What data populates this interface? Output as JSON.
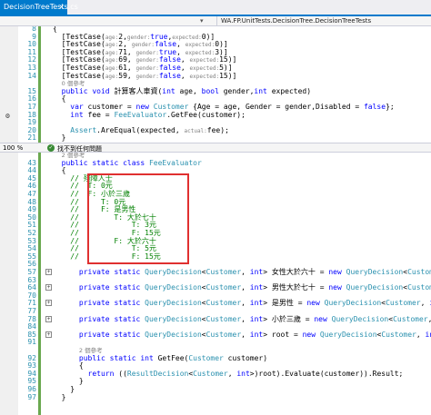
{
  "tabs": {
    "active": "DecisionTreeTests.cs",
    "close_glyph": "×",
    "dropdown_glyph": "▾"
  },
  "navbar": {
    "left_label": "",
    "dropdown_value": "WA.FP.UnitTests.DecisionTree.DecisionTreeTests"
  },
  "top_editor": {
    "lines": [
      {
        "n": "8",
        "html": "{"
      },
      {
        "n": "9",
        "html": "  [TestCase(<span class='pn'>age:</span>2,<span class='pn'>gender:</span><span class='kw'>true</span>,<span class='pn'>expected:</span>0)]"
      },
      {
        "n": "10",
        "html": "  [TestCase(<span class='pn'>age:</span>2, <span class='pn'>gender:</span><span class='kw'>false</span>, <span class='pn'>expected:</span>0)]"
      },
      {
        "n": "11",
        "html": "  [TestCase(<span class='pn'>age:</span>71, <span class='pn'>gender:</span><span class='kw'>true</span>, <span class='pn'>expected:</span>3)]"
      },
      {
        "n": "12",
        "html": "  [TestCase(<span class='pn'>age:</span>69, <span class='pn'>gender:</span><span class='kw'>false</span>, <span class='pn'>expected:</span>15)]"
      },
      {
        "n": "13",
        "html": "  [TestCase(<span class='pn'>age:</span>61, <span class='pn'>gender:</span><span class='kw'>false</span>, <span class='pn'>expected:</span>5)]"
      },
      {
        "n": "14",
        "html": "  [TestCase(<span class='pn'>age:</span>59, <span class='pn'>gender:</span><span class='kw'>false</span>, <span class='pn'>expected:</span>15)]"
      },
      {
        "n": "",
        "html": "  <span class='ref'>0 個參考</span>"
      },
      {
        "n": "15",
        "html": "  <span class='kw'>public void</span> 計算客人車資(<span class='kw'>int</span> age, <span class='kw'>bool</span> gender,<span class='kw'>int</span> expected)"
      },
      {
        "n": "16",
        "html": "  {"
      },
      {
        "n": "17",
        "html": "    <span class='kw'>var</span> customer = <span class='kw'>new</span> <span class='ty'>Customer</span> {Age = age, Gender = gender,Disabled = <span class='kw'>false</span>};"
      },
      {
        "n": "18",
        "html": "    <span class='kw'>int</span> fee = <span class='ty'>FeeEvaluator</span>.GetFee(customer);"
      },
      {
        "n": "19",
        "html": ""
      },
      {
        "n": "20",
        "html": "    <span class='ty'>Assert</span>.AreEqual(expected, <span class='pn'>actual:</span>fee);"
      },
      {
        "n": "21",
        "html": "  }"
      }
    ]
  },
  "status": {
    "zoom": "100 %",
    "issues_text": "找不到任何問題",
    "check_glyph": "✓"
  },
  "bottom_editor": {
    "lines": [
      {
        "n": "",
        "html": "  <span class='ref'>2 個參考</span>"
      },
      {
        "n": "43",
        "html": "  <span class='kw'>public static class</span> <span class='ty'>FeeEvaluator</span>"
      },
      {
        "n": "44",
        "html": "  {"
      },
      {
        "n": "45",
        "html": "    <span class='cm'>// 殘障人士</span>"
      },
      {
        "n": "46",
        "html": "    <span class='cm'>//  T: 0元</span>"
      },
      {
        "n": "47",
        "html": "    <span class='cm'>//  F: 小於三歲</span>"
      },
      {
        "n": "48",
        "html": "    <span class='cm'>//     T: 0元</span>"
      },
      {
        "n": "49",
        "html": "    <span class='cm'>//     F: 是男性</span>"
      },
      {
        "n": "50",
        "html": "    <span class='cm'>//        T: 大於七十</span>"
      },
      {
        "n": "51",
        "html": "    <span class='cm'>//            T: 3元</span>"
      },
      {
        "n": "52",
        "html": "    <span class='cm'>//            F: 15元</span>"
      },
      {
        "n": "53",
        "html": "    <span class='cm'>//        F: 大於六十</span>"
      },
      {
        "n": "54",
        "html": "    <span class='cm'>//            T: 5元</span>"
      },
      {
        "n": "55",
        "html": "    <span class='cm'>//            F: 15元</span>"
      },
      {
        "n": "56",
        "html": ""
      },
      {
        "n": "57",
        "html": "      <span class='kw'>private static</span> <span class='ty'>QueryDecision</span>&lt;<span class='ty'>Customer</span>, <span class='kw'>int</span>&gt; 女性大於六十 = <span class='kw'>new</span> <span class='ty'>QueryDecision</span>&lt;<span class='ty'>Customer</span>, <span class='kw'>int</span>&gt;<span class='coll'>...</span>;"
      },
      {
        "n": "63",
        "html": ""
      },
      {
        "n": "64",
        "html": "      <span class='kw'>private static</span> <span class='ty'>QueryDecision</span>&lt;<span class='ty'>Customer</span>, <span class='kw'>int</span>&gt; 男性大於七十 = <span class='kw'>new</span> <span class='ty'>QueryDecision</span>&lt;<span class='ty'>Customer</span>, <span class='kw'>int</span>&gt;<span class='coll'>...</span>;"
      },
      {
        "n": "70",
        "html": ""
      },
      {
        "n": "71",
        "html": "      <span class='kw'>private static</span> <span class='ty'>QueryDecision</span>&lt;<span class='ty'>Customer</span>, <span class='kw'>int</span>&gt; 是男性 = <span class='kw'>new</span> <span class='ty'>QueryDecision</span>&lt;<span class='ty'>Customer</span>, <span class='kw'>int</span>&gt;<span class='coll'>...</span>;"
      },
      {
        "n": "77",
        "html": ""
      },
      {
        "n": "78",
        "html": "      <span class='kw'>private static</span> <span class='ty'>QueryDecision</span>&lt;<span class='ty'>Customer</span>, <span class='kw'>int</span>&gt; 小於三歲 = <span class='kw'>new</span> <span class='ty'>QueryDecision</span>&lt;<span class='ty'>Customer</span>, <span class='kw'>int</span>&gt;<span class='coll'>...</span>;"
      },
      {
        "n": "84",
        "html": ""
      },
      {
        "n": "85",
        "html": "      <span class='kw'>private static</span> <span class='ty'>QueryDecision</span>&lt;<span class='ty'>Customer</span>, <span class='kw'>int</span>&gt; root = <span class='kw'>new</span> <span class='ty'>QueryDecision</span>&lt;<span class='ty'>Customer</span>, <span class='kw'>int</span>&gt;<span class='coll'>...</span>;"
      },
      {
        "n": "91",
        "html": ""
      },
      {
        "n": "",
        "html": "      <span class='ref'>2 個參考</span>"
      },
      {
        "n": "92",
        "html": "      <span class='kw'>public static int</span> GetFee(<span class='ty'>Customer</span> customer)"
      },
      {
        "n": "93",
        "html": "      {"
      },
      {
        "n": "94",
        "html": "        <span class='kw'>return</span> ((<span class='ty'>ResultDecision</span>&lt;<span class='ty'>Customer</span>, <span class='kw'>int</span>&gt;)root).Evaluate(customer)).Result;"
      },
      {
        "n": "95",
        "html": "      }"
      },
      {
        "n": "96",
        "html": "    }"
      },
      {
        "n": "97",
        "html": "  }"
      }
    ]
  }
}
